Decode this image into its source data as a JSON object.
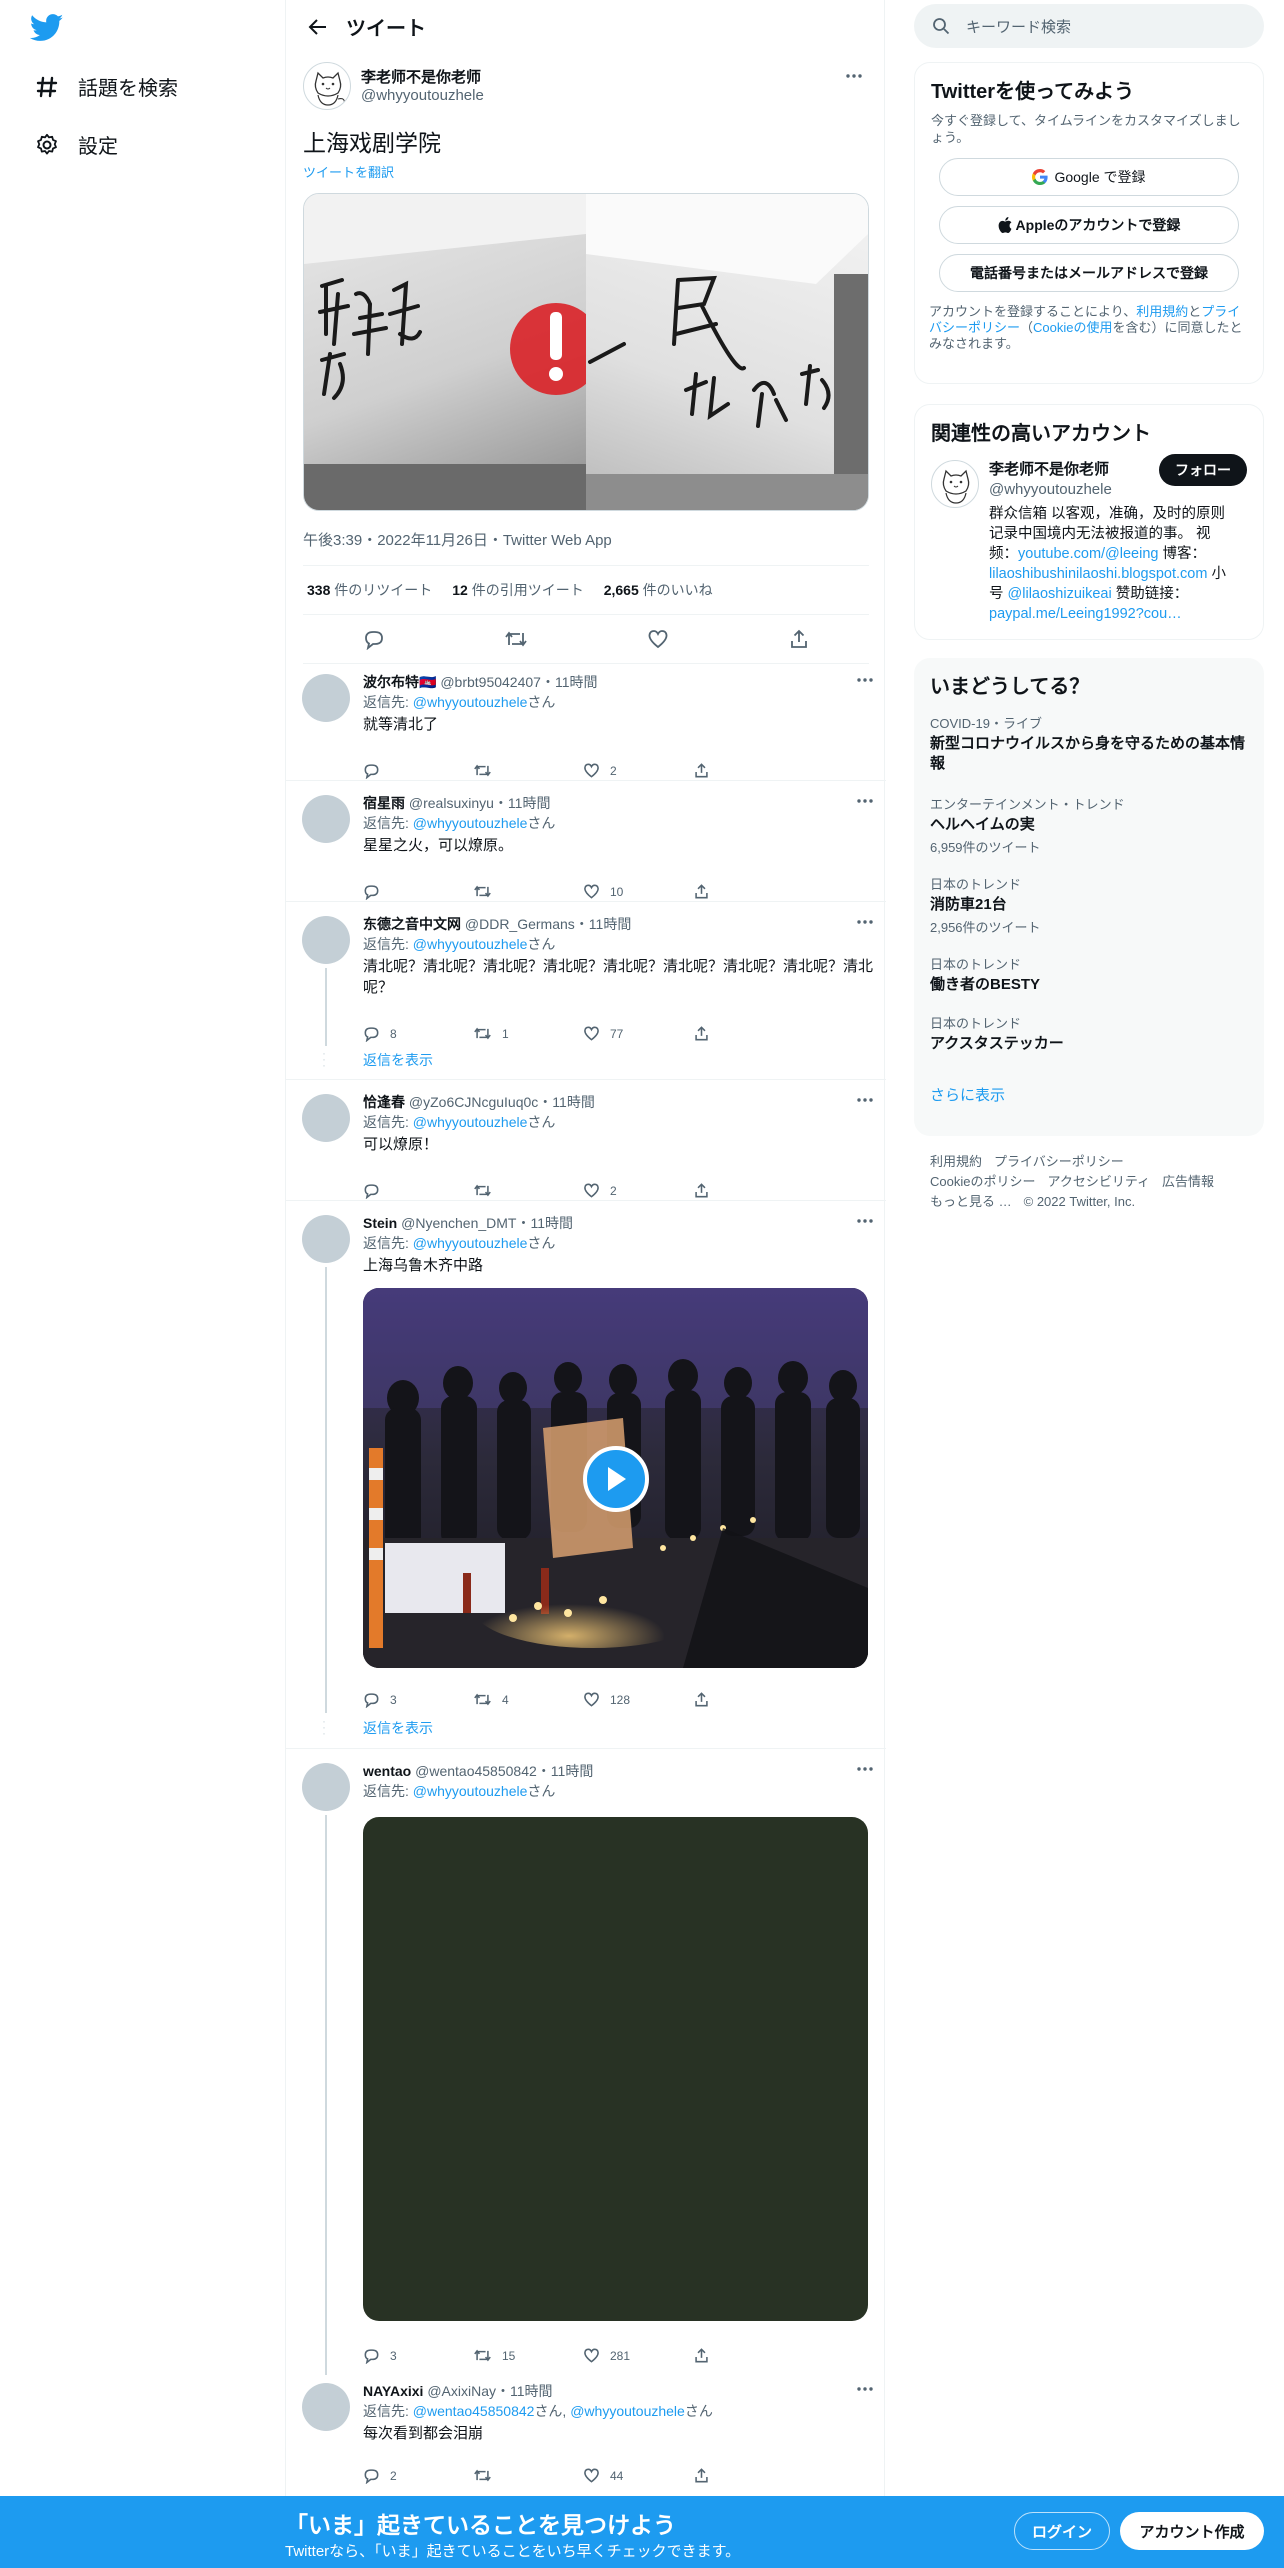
{
  "nav": {
    "logo": "twitter-bird-icon",
    "explore": "話題を検索",
    "settings": "設定"
  },
  "header": {
    "title": "ツイート"
  },
  "main_tweet": {
    "name": "李老师不是你老师",
    "handle": "@whyyoutouzhele",
    "text": "上海戏剧学院",
    "translate": "ツイートを翻訳",
    "meta": "午後3:39・2022年11月26日・Twitter Web App",
    "retweets_num": "338",
    "retweets_label": "件のリツイート",
    "quotes_num": "12",
    "quotes_label": "件の引用ツイート",
    "likes_num": "2,665",
    "likes_label": "件のいいね"
  },
  "replies": [
    {
      "name": "波尔布特🇰🇭",
      "handle": "@brbt95042407",
      "time": "・11時間",
      "reply_to_prefix": "返信先: ",
      "reply_to": "@whyyoutouzhele",
      "reply_to_suffix": "さん",
      "text": "就等清北了",
      "replies": "",
      "retweets": "",
      "likes": "2"
    },
    {
      "name": "宿星雨",
      "handle": "@realsuxinyu",
      "time": "・11時間",
      "reply_to_prefix": "返信先: ",
      "reply_to": "@whyyoutouzhele",
      "reply_to_suffix": "さん",
      "text": "星星之火，可以燎原。",
      "replies": "",
      "retweets": "",
      "likes": "10"
    },
    {
      "name": "东德之音中文网",
      "handle": "@DDR_Germans",
      "time": "・11時間",
      "reply_to_prefix": "返信先: ",
      "reply_to": "@whyyoutouzhele",
      "reply_to_suffix": "さん",
      "text": "清北呢？清北呢？清北呢？清北呢？清北呢？清北呢？清北呢？清北呢？清北呢？",
      "replies": "8",
      "retweets": "1",
      "likes": "77",
      "show_replies": "返信を表示"
    },
    {
      "name": "恰逢春",
      "handle": "@yZo6CJNcguIuq0c",
      "time": "・11時間",
      "reply_to_prefix": "返信先: ",
      "reply_to": "@whyyoutouzhele",
      "reply_to_suffix": "さん",
      "text": "可以燎原！",
      "replies": "",
      "retweets": "",
      "likes": "2"
    },
    {
      "name": "Stein",
      "handle": "@Nyenchen_DMT",
      "time": "・11時間",
      "reply_to_prefix": "返信先: ",
      "reply_to": "@whyyoutouzhele",
      "reply_to_suffix": "さん",
      "text": "上海乌鲁木齐中路",
      "replies": "3",
      "retweets": "4",
      "likes": "128",
      "show_replies": "返信を表示"
    },
    {
      "name": "wentao",
      "handle": "@wentao45850842",
      "time": "・11時間",
      "reply_to_prefix": "返信先: ",
      "reply_to": "@whyyoutouzhele",
      "reply_to_suffix": "さん",
      "text": "",
      "replies": "3",
      "retweets": "15",
      "likes": "281"
    },
    {
      "name": "NAYAxixi",
      "handle": "@AxixiNay",
      "time": "・11時間",
      "reply_to_prefix": "返信先: ",
      "reply_to": "@wentao45850842",
      "reply_to_mid": "さん, ",
      "reply_to2": "@whyyoutouzhele",
      "reply_to_suffix": "さん",
      "text": "每次看到都会泪崩",
      "replies": "2",
      "retweets": "",
      "likes": "44"
    }
  ],
  "right": {
    "search_placeholder": "キーワード検索",
    "signup_title": "Twitterを使ってみよう",
    "signup_desc": "今すぐ登録して、タイムラインをカスタマイズしましょう。",
    "google_btn": "Google で登録",
    "apple_btn": "Appleのアカウントで登録",
    "phone_btn": "電話番号またはメールアドレスで登録",
    "legal_1": "アカウントを登録することにより、",
    "legal_terms": "利用規約",
    "legal_2": "と",
    "legal_privacy": "プライバシーポリシー",
    "legal_3": "（",
    "legal_cookie": "Cookieの使用",
    "legal_4": "を含む）に同意したとみなされます。",
    "related_title": "関連性の高いアカウント",
    "related_name": "李老师不是你老师",
    "related_handle": "@whyyoutouzhele",
    "follow": "フォロー",
    "bio_1": "群众信箱 以客观，准确，及时的原则记录中国境内无法被报道的事。 视频：",
    "bio_link1": "youtube.com/@leeing",
    "bio_2": " 博客：",
    "bio_link2": "lilaoshibushinilaoshi.blogspot.com",
    "bio_3": " 小号 ",
    "bio_link3": "@lilaoshizuikeai",
    "bio_4": " 赞助链接：",
    "bio_link4": "paypal.me/Leeing1992?cou…",
    "trends_title": "いまどうしてる？",
    "trends": [
      {
        "cat": "COVID-19・ライブ",
        "title": "新型コロナウイルスから身を守るための基本情報",
        "count": ""
      },
      {
        "cat": "エンターテインメント・トレンド",
        "title": "ヘルヘイムの実",
        "count": "6,959件のツイート"
      },
      {
        "cat": "日本のトレンド",
        "title": "消防車21台",
        "count": "2,956件のツイート"
      },
      {
        "cat": "日本のトレンド",
        "title": "働き者のBESTY",
        "count": ""
      },
      {
        "cat": "日本のトレンド",
        "title": "アクスタステッカー",
        "count": ""
      }
    ],
    "show_more": "さらに表示",
    "footer": [
      "利用規約",
      "プライバシーポリシー",
      "Cookieのポリシー",
      "アクセシビリティ",
      "広告情報",
      "もっと見る …",
      "© 2022 Twitter, Inc."
    ]
  },
  "bottom": {
    "title": "「いま」起きていることを見つけよう",
    "sub": "Twitterなら、「いま」起きていることをいち早くチェックできます。",
    "login": "ログイン",
    "signup": "アカウント作成"
  },
  "colors": {
    "accent": "#1d9bf0",
    "text": "#0f1419",
    "muted": "#536471"
  }
}
